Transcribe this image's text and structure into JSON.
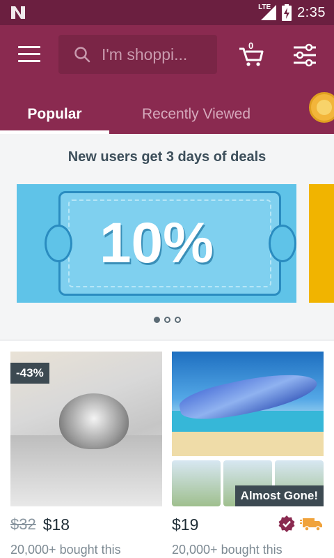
{
  "status_bar": {
    "network": "LTE",
    "time": "2:35"
  },
  "search": {
    "placeholder": "I'm shoppi..."
  },
  "cart": {
    "count": "0"
  },
  "tabs": [
    {
      "label": "Popular",
      "active": true
    },
    {
      "label": "Recently Viewed",
      "active": false
    }
  ],
  "promo": {
    "title": "New users get 3 days of deals",
    "banner_text": "10%",
    "pagination": {
      "total": 3,
      "current": 1
    }
  },
  "products": [
    {
      "discount": "-43%",
      "old_price": "$32",
      "price": "$18",
      "bought": "20,000+ bought this",
      "image": "wolf-bedding-image"
    },
    {
      "badge": "Almost Gone!",
      "price": "$19",
      "bought": "20,000+ bought this",
      "image": "hammock-image"
    }
  ],
  "colors": {
    "status_bar": "#6b1f40",
    "app_bar": "#8a2a50",
    "accent_badge": "#8a2a50",
    "shipping_icon": "#f0a23a"
  }
}
